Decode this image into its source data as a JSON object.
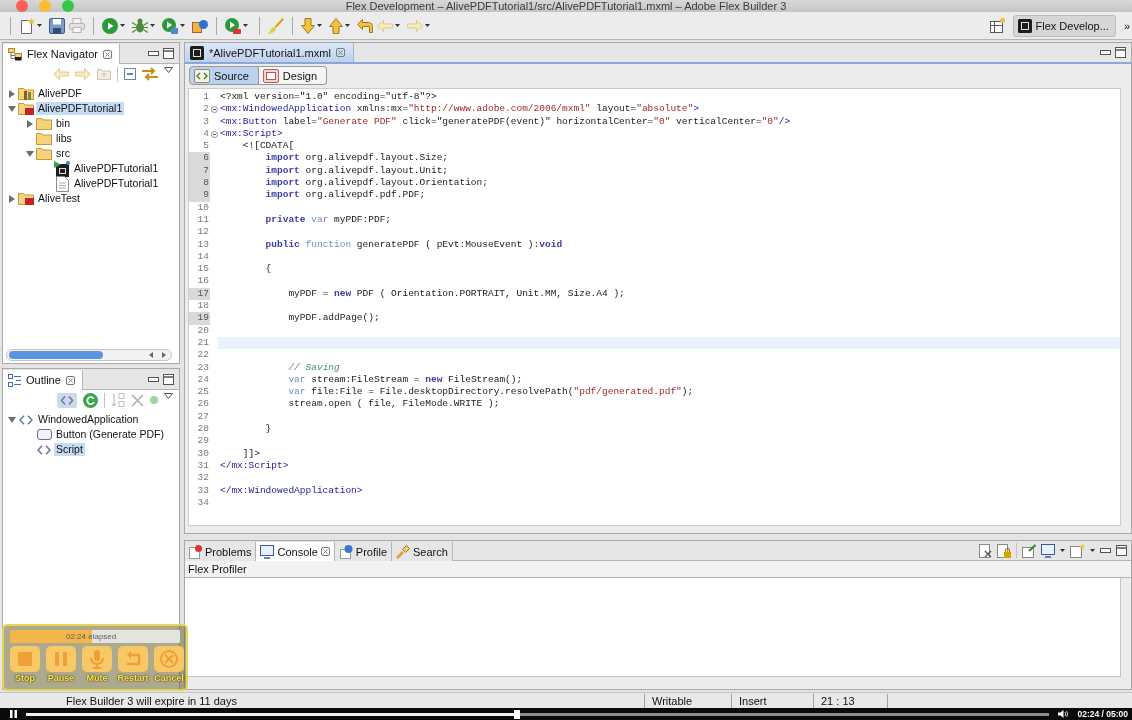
{
  "window": {
    "title": "Flex Development – AlivePDFTutorial1/src/AlivePDFTutorial1.mxml – Adobe Flex Builder 3"
  },
  "toolbar": {
    "perspective": "Flex Develop...",
    "more": "»"
  },
  "navigator": {
    "title": "Flex Navigator",
    "tree": [
      {
        "label": "AlivePDF",
        "kind": "library-project",
        "expanded": false,
        "selected": false
      },
      {
        "label": "AlivePDFTutorial1",
        "kind": "air-project",
        "expanded": true,
        "selected": true,
        "children": [
          {
            "label": "bin",
            "kind": "folder",
            "expanded": false,
            "selected": false
          },
          {
            "label": "libs",
            "kind": "folder",
            "selected": false
          },
          {
            "label": "src",
            "kind": "folder",
            "expanded": true,
            "selected": false,
            "children": [
              {
                "label": "AlivePDFTutorial1",
                "kind": "mxml-file",
                "selected": false
              },
              {
                "label": "AlivePDFTutorial1",
                "kind": "file",
                "selected": false
              }
            ]
          }
        ]
      },
      {
        "label": "AliveTest",
        "kind": "air-project",
        "expanded": false,
        "selected": false
      }
    ]
  },
  "outline": {
    "title": "Outline",
    "tree": [
      {
        "label": "WindowedApplication",
        "kind": "tag",
        "expanded": true,
        "selected": false,
        "children": [
          {
            "label": "Button (Generate PDF)",
            "kind": "button",
            "selected": false
          },
          {
            "label": "Script",
            "kind": "tag",
            "selected": true
          }
        ]
      }
    ]
  },
  "editor": {
    "tabs": [
      {
        "label": "*AlivePDFTutorial1.mxml",
        "selected": true
      }
    ],
    "modes": [
      {
        "label": "Source",
        "kind": "source",
        "selected": true
      },
      {
        "label": "Design",
        "kind": "design",
        "selected": false
      }
    ],
    "lines": [
      {
        "number": "1",
        "fold": false,
        "changed": false,
        "current": false,
        "tokens": [
          {
            "kind": "plain",
            "text": "<?xml version=\"1.0\" encoding=\"utf-8\"?>"
          }
        ]
      },
      {
        "number": "2",
        "fold": true,
        "changed": false,
        "current": false,
        "tokens": [
          {
            "kind": "tag",
            "text": "<mx:WindowedApplication"
          },
          {
            "kind": "plain",
            "text": " xmlns:mx="
          },
          {
            "kind": "string",
            "text": "\"http://www.adobe.com/2006/mxml\""
          },
          {
            "kind": "plain",
            "text": " layout="
          },
          {
            "kind": "string",
            "text": "\"absolute\""
          },
          {
            "kind": "tag",
            "text": ">"
          }
        ]
      },
      {
        "number": "3",
        "fold": false,
        "changed": false,
        "current": false,
        "tokens": [
          {
            "kind": "tag",
            "text": "<mx:Button"
          },
          {
            "kind": "plain",
            "text": " label="
          },
          {
            "kind": "string",
            "text": "\"Generate PDF\""
          },
          {
            "kind": "plain",
            "text": " click=\"generatePDF(event)\" horizontalCenter="
          },
          {
            "kind": "string",
            "text": "\"0\""
          },
          {
            "kind": "plain",
            "text": " verticalCenter="
          },
          {
            "kind": "string",
            "text": "\"0\""
          },
          {
            "kind": "tag",
            "text": "/>"
          }
        ]
      },
      {
        "number": "4",
        "fold": true,
        "changed": false,
        "current": false,
        "tokens": [
          {
            "kind": "tag",
            "text": "<mx:Script>"
          }
        ]
      },
      {
        "number": "5",
        "fold": false,
        "changed": false,
        "current": false,
        "tokens": [
          {
            "kind": "plain",
            "text": "    <![CDATA["
          }
        ]
      },
      {
        "number": "6",
        "fold": false,
        "changed": true,
        "current": false,
        "tokens": [
          {
            "kind": "keyword",
            "text": "        import"
          },
          {
            "kind": "plain",
            "text": " org.alivepdf.layout.Size;"
          }
        ]
      },
      {
        "number": "7",
        "fold": false,
        "changed": true,
        "current": false,
        "tokens": [
          {
            "kind": "keyword",
            "text": "        import"
          },
          {
            "kind": "plain",
            "text": " org.alivepdf.layout.Unit;"
          }
        ]
      },
      {
        "number": "8",
        "fold": false,
        "changed": true,
        "current": false,
        "tokens": [
          {
            "kind": "keyword",
            "text": "        import"
          },
          {
            "kind": "plain",
            "text": " org.alivepdf.layout.Orientation;"
          }
        ]
      },
      {
        "number": "9",
        "fold": false,
        "changed": true,
        "current": false,
        "tokens": [
          {
            "kind": "keyword",
            "text": "        import"
          },
          {
            "kind": "plain",
            "text": " org.alivepdf.pdf.PDF;"
          }
        ]
      },
      {
        "number": "10",
        "fold": false,
        "changed": false,
        "current": false
      },
      {
        "number": "11",
        "fold": false,
        "changed": false,
        "current": false,
        "tokens": [
          {
            "kind": "keyword",
            "text": "        private"
          },
          {
            "kind": "keyword2",
            "text": " var"
          },
          {
            "kind": "plain",
            "text": " myPDF:PDF;"
          }
        ]
      },
      {
        "number": "12",
        "fold": false,
        "changed": false,
        "current": false
      },
      {
        "number": "13",
        "fold": false,
        "changed": false,
        "current": false,
        "tokens": [
          {
            "kind": "keyword",
            "text": "        public"
          },
          {
            "kind": "keyword2",
            "text": " function"
          },
          {
            "kind": "plain",
            "text": " generatePDF ( pEvt:MouseEvent ):"
          },
          {
            "kind": "keyword",
            "text": "void"
          }
        ]
      },
      {
        "number": "14",
        "fold": false,
        "changed": false,
        "current": false
      },
      {
        "number": "15",
        "fold": false,
        "changed": false,
        "current": false,
        "tokens": [
          {
            "kind": "plain",
            "text": "        {"
          }
        ]
      },
      {
        "number": "16",
        "fold": false,
        "changed": false,
        "current": false
      },
      {
        "number": "17",
        "fold": false,
        "changed": true,
        "current": false,
        "tokens": [
          {
            "kind": "plain",
            "text": "            myPDF = "
          },
          {
            "kind": "keyword",
            "text": "new"
          },
          {
            "kind": "plain",
            "text": " PDF ( Orientation.PORTRAIT, Unit.MM, Size.A4 );"
          }
        ]
      },
      {
        "number": "18",
        "fold": false,
        "changed": false,
        "current": false
      },
      {
        "number": "19",
        "fold": false,
        "changed": true,
        "current": false,
        "tokens": [
          {
            "kind": "plain",
            "text": "            myPDF.addPage();"
          }
        ]
      },
      {
        "number": "20",
        "fold": false,
        "changed": false,
        "current": false
      },
      {
        "number": "21",
        "fold": false,
        "changed": false,
        "current": true
      },
      {
        "number": "22",
        "fold": false,
        "changed": false,
        "current": false
      },
      {
        "number": "23",
        "fold": false,
        "changed": false,
        "current": false,
        "tokens": [
          {
            "kind": "comment",
            "text": "            // Saving"
          }
        ]
      },
      {
        "number": "24",
        "fold": false,
        "changed": false,
        "current": false,
        "tokens": [
          {
            "kind": "keyword2",
            "text": "            var"
          },
          {
            "kind": "plain",
            "text": " stream:FileStream = "
          },
          {
            "kind": "keyword",
            "text": "new"
          },
          {
            "kind": "plain",
            "text": " FileStream();"
          }
        ]
      },
      {
        "number": "25",
        "fold": false,
        "changed": false,
        "current": false,
        "tokens": [
          {
            "kind": "keyword2",
            "text": "            var"
          },
          {
            "kind": "plain",
            "text": " file:File = File.desktopDirectory.resolvePath("
          },
          {
            "kind": "string",
            "text": "\"pdf/generated.pdf\""
          },
          {
            "kind": "plain",
            "text": ");"
          }
        ]
      },
      {
        "number": "26",
        "fold": false,
        "changed": false,
        "current": false,
        "tokens": [
          {
            "kind": "plain",
            "text": "            stream.open ( file, FileMode.WRITE );"
          }
        ]
      },
      {
        "number": "27",
        "fold": false,
        "changed": false,
        "current": false
      },
      {
        "number": "28",
        "fold": false,
        "changed": false,
        "current": false,
        "tokens": [
          {
            "kind": "plain",
            "text": "        }"
          }
        ]
      },
      {
        "number": "29",
        "fold": false,
        "changed": false,
        "current": false
      },
      {
        "number": "30",
        "fold": false,
        "changed": false,
        "current": false,
        "tokens": [
          {
            "kind": "plain",
            "text": "    ]]>"
          }
        ]
      },
      {
        "number": "31",
        "fold": false,
        "changed": false,
        "current": false,
        "tokens": [
          {
            "kind": "tag",
            "text": "</mx:Script>"
          }
        ]
      },
      {
        "number": "32",
        "fold": false,
        "changed": false,
        "current": false
      },
      {
        "number": "33",
        "fold": false,
        "changed": false,
        "current": false,
        "tokens": [
          {
            "kind": "tag",
            "text": "</mx:WindowedApplication>"
          }
        ]
      },
      {
        "number": "34",
        "fold": false,
        "changed": false,
        "current": false
      }
    ]
  },
  "bottom_panel": {
    "tabs": [
      {
        "label": "Problems",
        "kind": "problems",
        "selected": false
      },
      {
        "label": "Console",
        "kind": "console",
        "selected": true
      },
      {
        "label": "Profile",
        "kind": "profile",
        "selected": false
      },
      {
        "label": "Search",
        "kind": "search",
        "selected": false
      }
    ],
    "heading": "Flex Profiler"
  },
  "status_bar": {
    "message": "Flex Builder 3 will expire in 11 days",
    "fields": [
      "Writable",
      "Insert",
      "21 : 13"
    ]
  },
  "video_player": {
    "playing": true,
    "level": 0.48,
    "time": "02:24 / 05:00"
  },
  "recorder": {
    "level": 0.48,
    "elapsed": "02:24 elapsed",
    "buttons": [
      {
        "label": "Stop",
        "kind": "stop"
      },
      {
        "label": "Pause",
        "kind": "pause"
      },
      {
        "label": "Mute",
        "kind": "mute"
      },
      {
        "label": "Restart",
        "kind": "restart"
      },
      {
        "label": "Cancel",
        "kind": "cancel"
      }
    ]
  }
}
